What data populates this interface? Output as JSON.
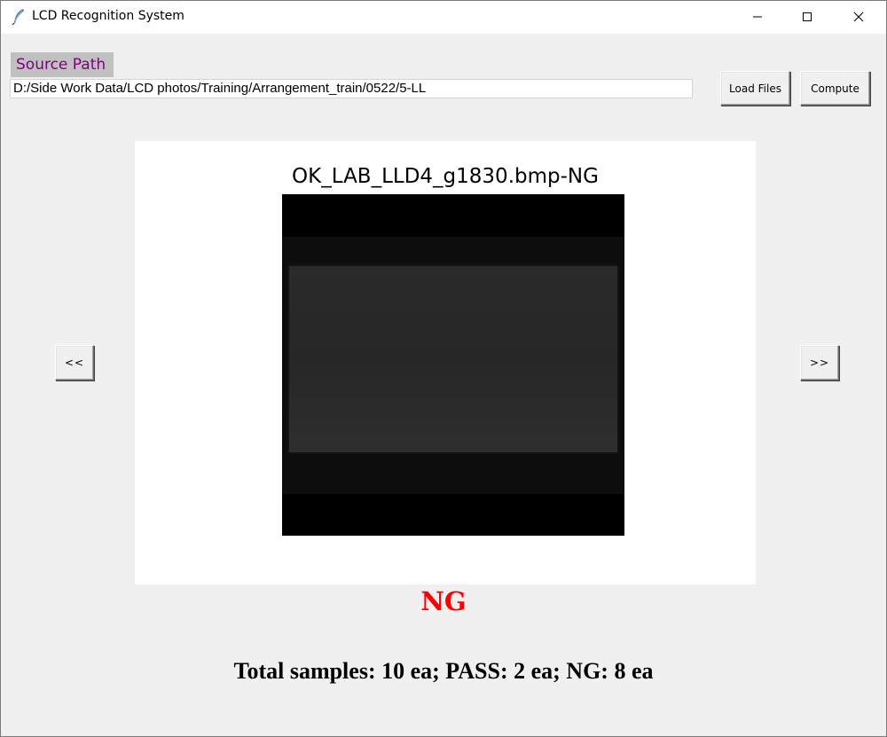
{
  "window": {
    "title": "LCD Recognition System",
    "app_icon": "feather-icon",
    "controls": [
      "minimize-icon",
      "maximize-icon",
      "close-icon"
    ]
  },
  "source": {
    "label": "Source Path",
    "path_value": "D:/Side Work Data/LCD photos/Training/Arrangement_train/0522/5-LL"
  },
  "toolbar": {
    "load_label": "Load Files",
    "compute_label": "Compute"
  },
  "navigation": {
    "prev_label": "<<",
    "next_label": ">>"
  },
  "viewer": {
    "image_title": "OK_LAB_LLD4_g1830.bmp-NG"
  },
  "result": {
    "label": "NG",
    "color": "#ff0000"
  },
  "summary": {
    "text": "Total samples: 10 ea; PASS: 2 ea; NG: 8 ea"
  },
  "colors": {
    "label_bg": "#c0c0c0",
    "label_text": "#800080"
  }
}
